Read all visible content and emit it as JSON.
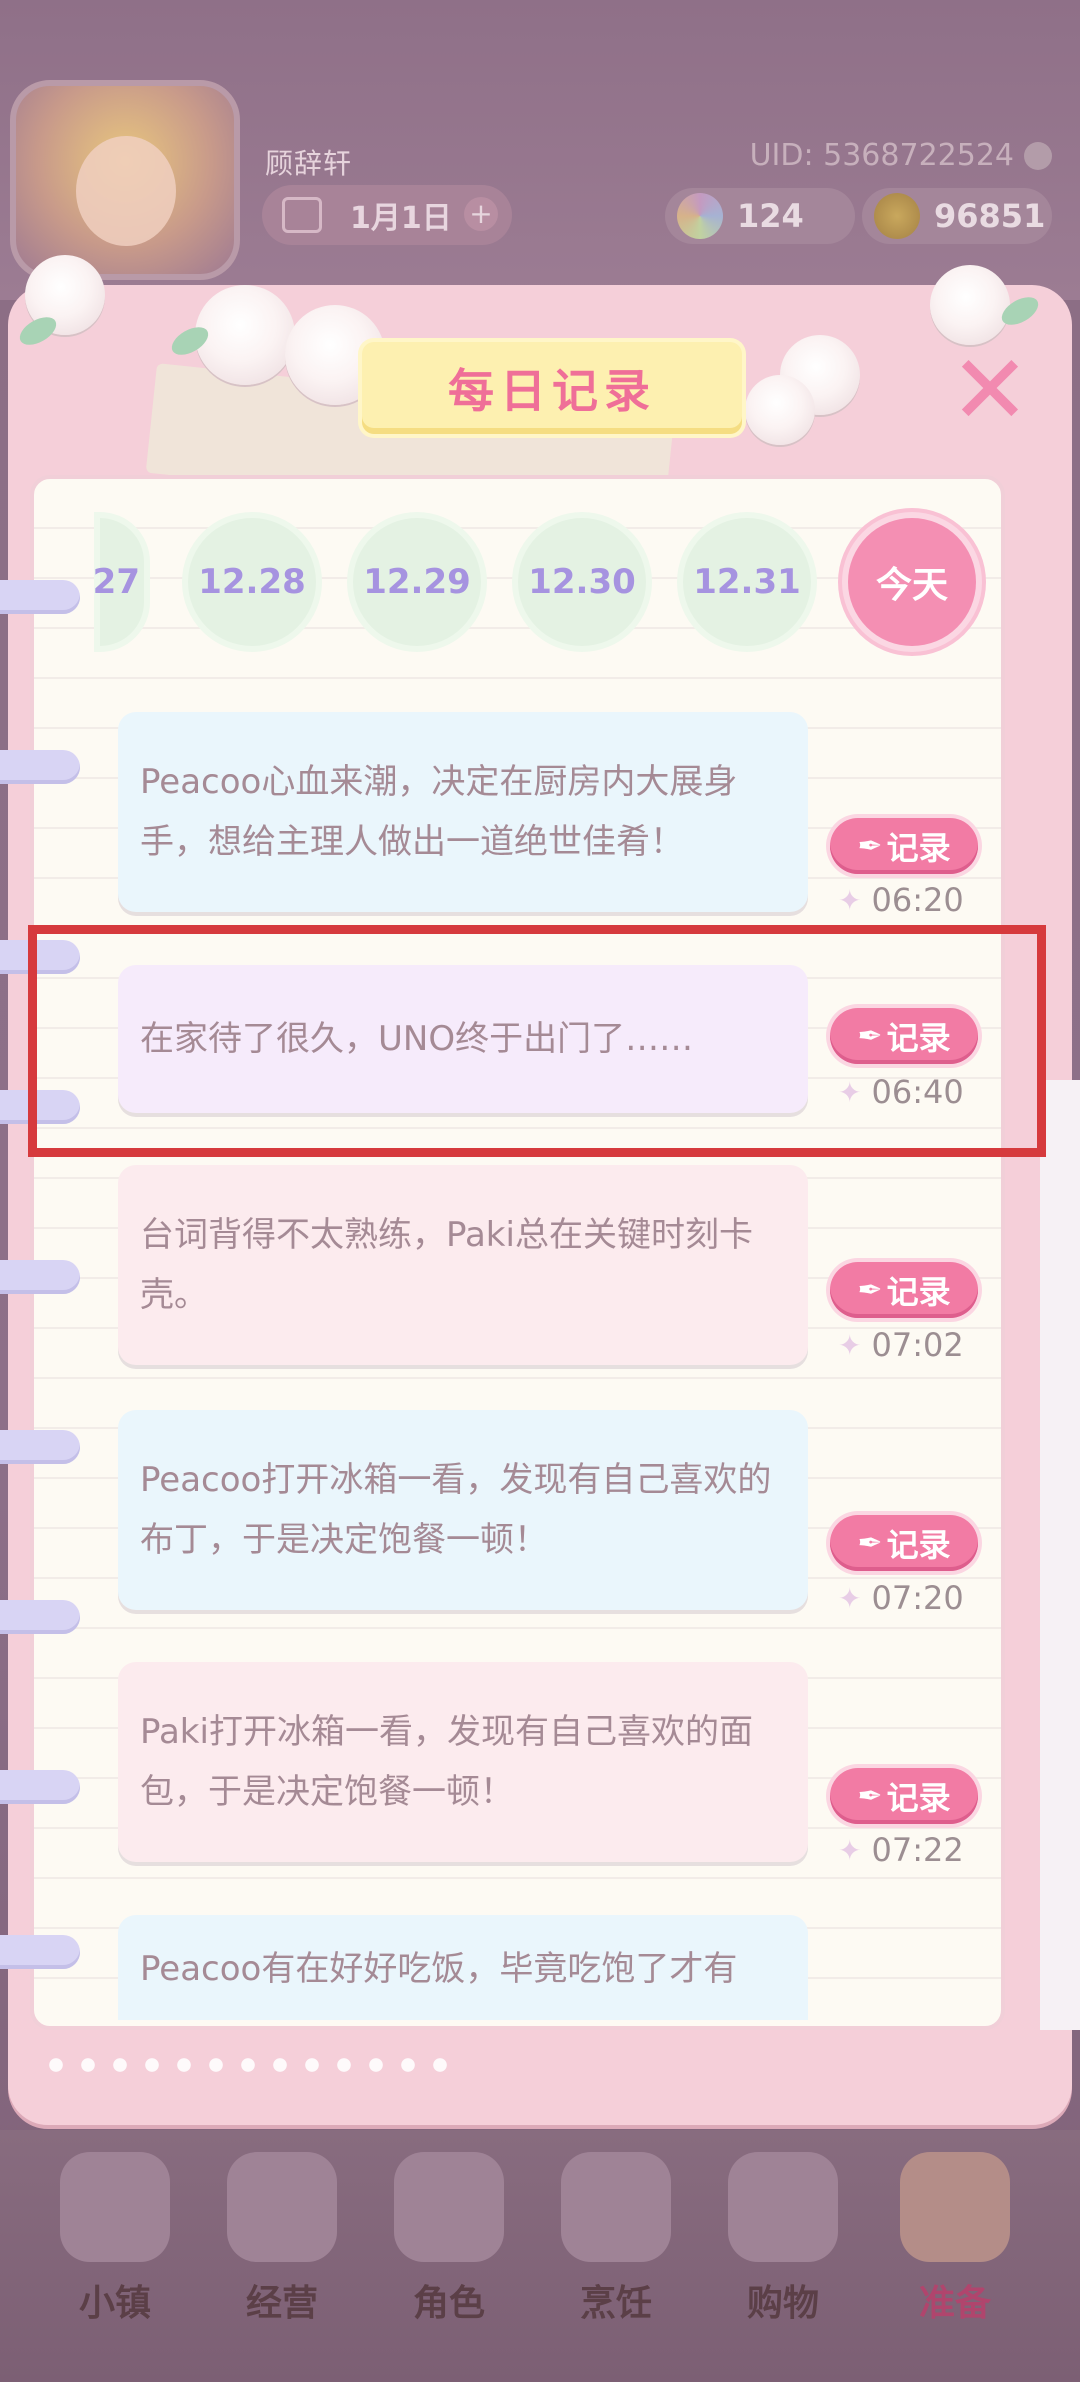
{
  "header": {
    "username": "顾辞轩",
    "uid": "UID: 5368722524",
    "date": "1月1日",
    "date_plus": "+",
    "currency_gem": "124",
    "currency_coin": "96851"
  },
  "panel": {
    "title": "每日记录",
    "close": "✕"
  },
  "date_tabs": [
    {
      "label": "27"
    },
    {
      "label": "12.28"
    },
    {
      "label": "12.29"
    },
    {
      "label": "12.30"
    },
    {
      "label": "12.31"
    },
    {
      "label": "今天"
    }
  ],
  "records": [
    {
      "text": "Peacoo心血来潮，决定在厨房内大展身手，想给主理人做出一道绝世佳肴！",
      "button": "记录",
      "time": "06:20"
    },
    {
      "text": "在家待了很久，UNO终于出门了……",
      "button": "记录",
      "time": "06:40"
    },
    {
      "text": "台词背得不太熟练，Paki总在关键时刻卡壳。",
      "button": "记录",
      "time": "07:02"
    },
    {
      "text": "Peacoo打开冰箱一看，发现有自己喜欢的布丁，于是决定饱餐一顿！",
      "button": "记录",
      "time": "07:20"
    },
    {
      "text": "Paki打开冰箱一看，发现有自己喜欢的面包，于是决定饱餐一顿！",
      "button": "记录",
      "time": "07:22"
    },
    {
      "text": "Peacoo有在好好吃饭，毕竟吃饱了才有"
    }
  ],
  "nav": [
    {
      "label": "小镇",
      "icon": "map-icon"
    },
    {
      "label": "经营",
      "icon": "hat-icon"
    },
    {
      "label": "角色",
      "icon": "character-icon"
    },
    {
      "label": "烹饪",
      "icon": "sandwich-icon"
    },
    {
      "label": "购物",
      "icon": "shopping-bag-icon"
    },
    {
      "label": "准备",
      "icon": "basket-icon"
    }
  ],
  "colors": {
    "accent": "#f27ba4",
    "title": "#ef6f98",
    "date_tab_text": "#a693e0",
    "highlight": "#d63a3d"
  }
}
